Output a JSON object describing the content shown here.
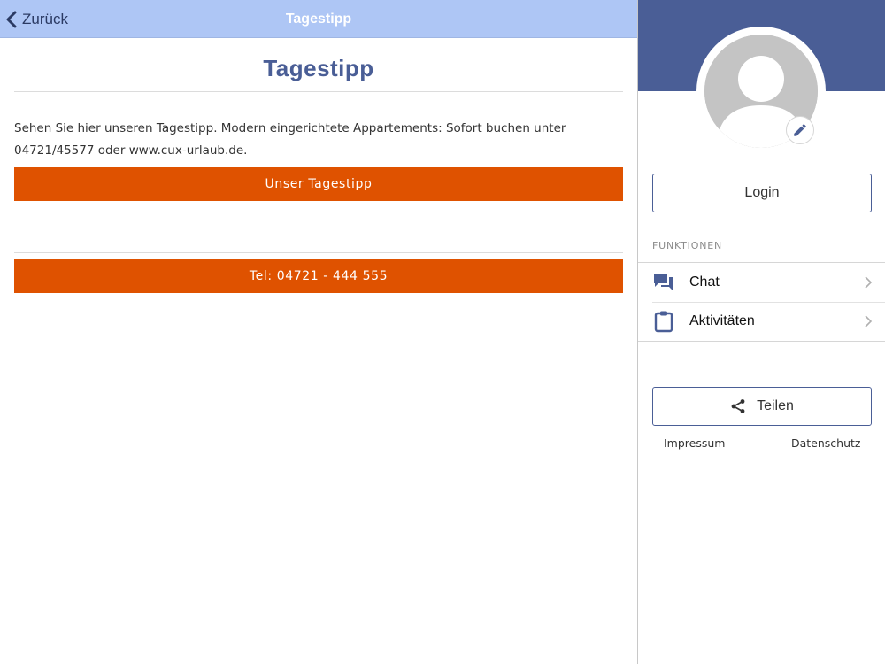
{
  "navbar": {
    "back_label": "Zurück",
    "title": "Tagestipp"
  },
  "main": {
    "heading": "Tagestipp",
    "body_text": "Sehen Sie hier unseren Tagestipp. Modern eingerichtete Appartements: Sofort buchen unter 04721/45577 oder www.cux-urlaub.de.",
    "primary_button": "Unser Tagestipp",
    "phone_button": "Tel: 04721 - 444 555"
  },
  "sidebar": {
    "login_label": "Login",
    "section_label": "FUNKTIONEN",
    "items": [
      {
        "label": "Chat",
        "icon": "chat-icon"
      },
      {
        "label": "Aktivitäten",
        "icon": "clipboard-icon"
      }
    ],
    "share_label": "Teilen",
    "footer": {
      "impressum": "Impressum",
      "datenschutz": "Datenschutz"
    }
  },
  "colors": {
    "navbar_bg": "#aec6f5",
    "accent_blue": "#4a5e96",
    "orange": "#df5200"
  }
}
